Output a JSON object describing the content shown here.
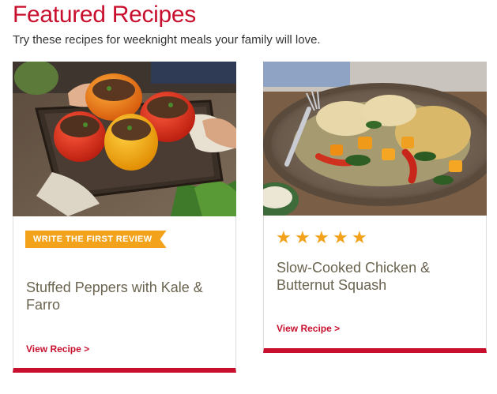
{
  "header": {
    "title": "Featured Recipes",
    "subtitle": "Try these recipes for weeknight meals your family will love."
  },
  "recipes": [
    {
      "title": "Stuffed Peppers with Kale & Farro",
      "badge": "WRITE THE FIRST REVIEW",
      "link_label": "View Recipe >",
      "image_icon": "stuffed-peppers-photo"
    },
    {
      "title": "Slow-Cooked Chicken & Butternut Squash",
      "rating": 5,
      "rating_max": 5,
      "stars": "★★★★★",
      "link_label": "View Recipe >",
      "image_icon": "chicken-squash-photo"
    }
  ],
  "colors": {
    "accent": "#c8102e",
    "badge": "#f2a31b",
    "title_text": "#6b6450"
  }
}
